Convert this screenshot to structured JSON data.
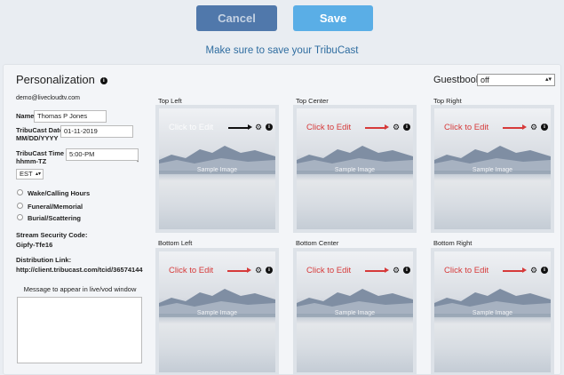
{
  "actions": {
    "cancel_label": "Cancel",
    "save_label": "Save"
  },
  "notice": "Make sure to save your TribuCast",
  "panel": {
    "title": "Personalization",
    "guestbook_label": "Guestbook",
    "guestbook_value": "off",
    "email": "demo@livecloudtv.com",
    "name_label": "Name",
    "name_value": "Thomas P Jones",
    "date_label_1": "TribuCast Date",
    "date_label_2": "MM/DD/YYYY",
    "date_value": "01-11-2019",
    "time_label_1": "TribuCast Time",
    "time_label_2": "hhmm-TZ",
    "time_value": "5:00-PM",
    "tz_value": "EST",
    "options": [
      "Wake/Calling Hours",
      "Funeral/Memorial",
      "Burial/Scattering"
    ],
    "security_label": "Stream Security Code:",
    "security_value": "Gipfy-Tfe16",
    "link_label": "Distribution Link:",
    "link_value": "http://client.tribucast.com/tcid/36574144",
    "message_label": "Message to appear in live/vod window"
  },
  "tiles": [
    {
      "label": "Top Left",
      "edit": "Click to Edit",
      "sample": "Sample Image"
    },
    {
      "label": "Top Center",
      "edit": "Click to Edit",
      "sample": "Sample Image"
    },
    {
      "label": "Top Right",
      "edit": "Click to Edit",
      "sample": "Sample Image"
    },
    {
      "label": "Bottom Left",
      "edit": "Click to Edit",
      "sample": "Sample Image"
    },
    {
      "label": "Bottom Center",
      "edit": "Click to Edit",
      "sample": "Sample Image"
    },
    {
      "label": "Bottom Right",
      "edit": "Click to Edit",
      "sample": "Sample Image"
    }
  ],
  "colors": {
    "accent": "#5aaee6",
    "cancel": "#5078ab",
    "edit_text": "#d63a3a"
  }
}
